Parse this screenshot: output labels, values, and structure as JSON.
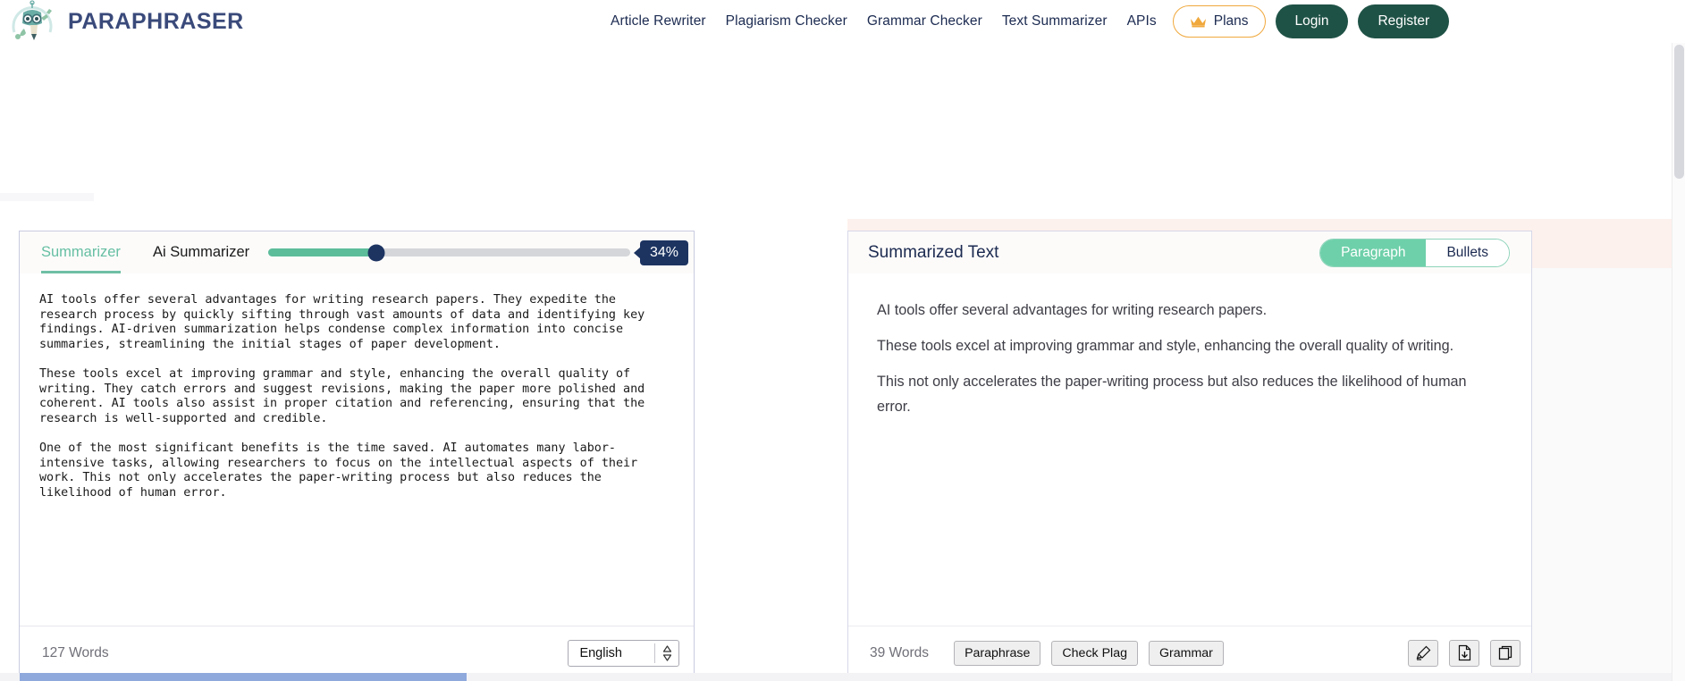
{
  "header": {
    "brand_name": "PARAPHRASER",
    "logo_icon": "robot-pencil-logo",
    "nav_links": [
      {
        "label": "Article Rewriter"
      },
      {
        "label": "Plagiarism Checker"
      },
      {
        "label": "Grammar Checker"
      },
      {
        "label": "Text Summarizer"
      },
      {
        "label": "APIs"
      }
    ],
    "plans_button": {
      "label": "Plans",
      "icon": "crown-icon",
      "border_color": "#f0a83c"
    },
    "login_button": {
      "label": "Login",
      "color": "#1f5246"
    },
    "register_button": {
      "label": "Register",
      "color": "#1f5246"
    }
  },
  "left_panel": {
    "tabs": [
      {
        "label": "Summarizer",
        "active": true
      },
      {
        "label": "Ai Summarizer",
        "active": false
      }
    ],
    "slider": {
      "value": 34,
      "value_label": "34%",
      "fill_color": "#5cbd9a",
      "thumb_color": "#1d3461",
      "track_color": "#d4d6d9"
    },
    "editor_text": "AI tools offer several advantages for writing research papers. They expedite the research process by quickly sifting through vast amounts of data and identifying key findings. AI-driven summarization helps condense complex information into concise summaries, streamlining the initial stages of paper development.\n\nThese tools excel at improving grammar and style, enhancing the overall quality of writing. They catch errors and suggest revisions, making the paper more polished and coherent. AI tools also assist in proper citation and referencing, ensuring that the research is well-supported and credible.\n\nOne of the most significant benefits is the time saved. AI automates many labor-intensive tasks, allowing researchers to focus on the intellectual aspects of their work. This not only accelerates the paper-writing process but also reduces the likelihood of human error.",
    "word_count": "127 Words",
    "language_select": {
      "value": "English",
      "icon": "chevron-updown-icon"
    }
  },
  "right_panel": {
    "title": "Summarized Text",
    "view_modes": [
      {
        "label": "Paragraph",
        "active": true
      },
      {
        "label": "Bullets",
        "active": false
      }
    ],
    "summary_paragraphs": [
      "AI tools offer several advantages for writing research papers.",
      "These tools excel at improving grammar and style, enhancing the overall quality of writing.",
      "This not only accelerates the paper-writing process but also reduces the likelihood of human error."
    ],
    "word_count": "39 Words",
    "actions": [
      {
        "label": "Paraphrase"
      },
      {
        "label": "Check Plag"
      },
      {
        "label": "Grammar"
      }
    ],
    "icon_actions": [
      {
        "icon": "highlighter-pen-icon"
      },
      {
        "icon": "download-document-icon"
      },
      {
        "icon": "copy-icon"
      }
    ]
  },
  "colors": {
    "brand_navy": "#3a4a7a",
    "accent_green": "#6ed0aa",
    "dark_green": "#1f5246",
    "accent_orange": "#f0a83c",
    "badge_navy": "#1d3461",
    "pink_band": "#fdf1ed"
  }
}
